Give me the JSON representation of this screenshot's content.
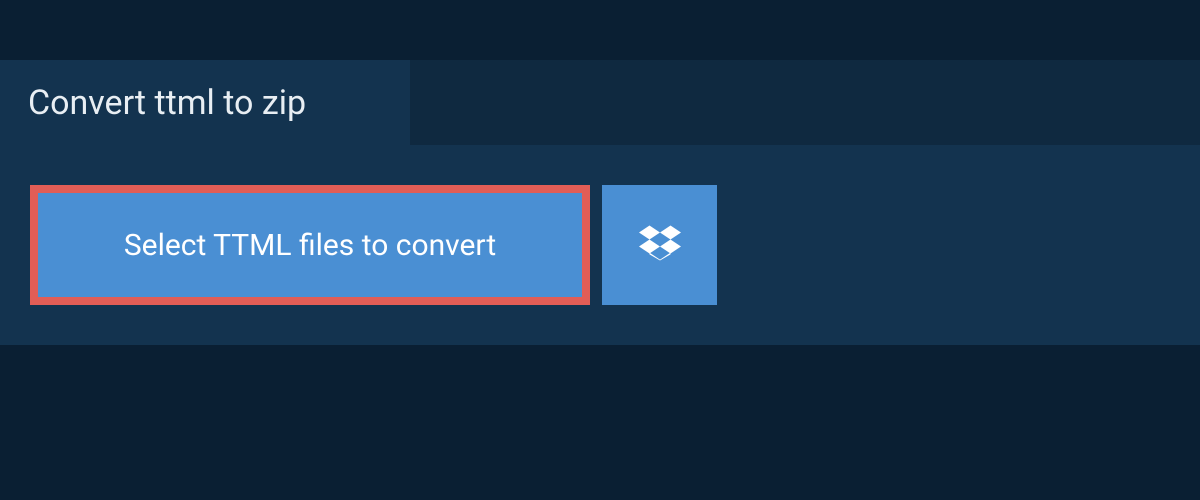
{
  "header": {
    "title": "Convert ttml to zip"
  },
  "actions": {
    "select_files_label": "Select TTML files to convert"
  },
  "icons": {
    "dropbox": "dropbox-icon"
  },
  "colors": {
    "page_bg": "#0f2940",
    "dark_bg": "#0a1f33",
    "panel_bg": "#13334f",
    "button_bg": "#4a8fd3",
    "highlight_border": "#e15d56",
    "text_light": "#e8eef3",
    "text_white": "#ffffff"
  }
}
